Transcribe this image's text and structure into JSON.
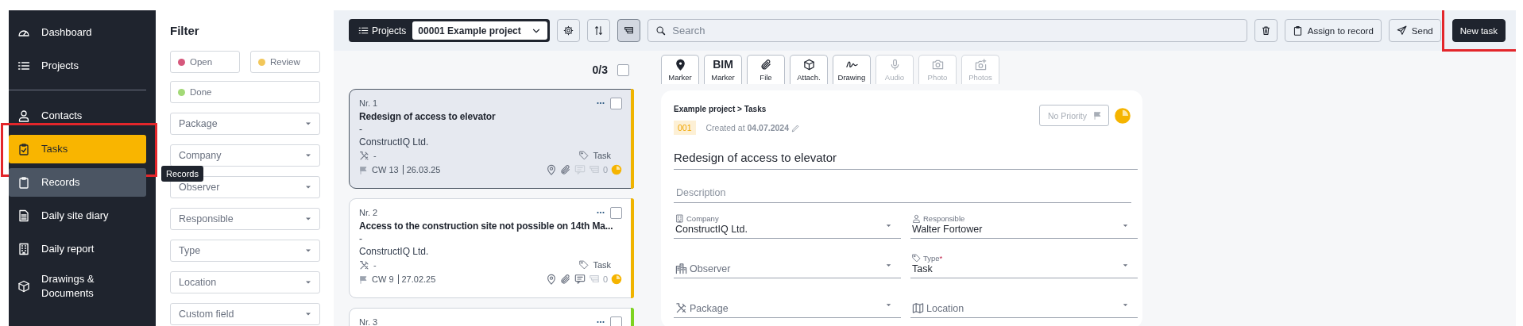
{
  "sidebar": {
    "items": [
      {
        "kind": "dashboard",
        "label": "Dashboard",
        "selected": false,
        "hovered": false
      },
      {
        "kind": "projects",
        "label": "Projects",
        "selected": false,
        "hovered": false,
        "divider_after": true
      },
      {
        "kind": "contacts",
        "label": "Contacts",
        "selected": false,
        "hovered": false
      },
      {
        "kind": "tasks",
        "label": "Tasks",
        "selected": true,
        "hovered": false,
        "highlighted": true
      },
      {
        "kind": "records",
        "label": "Records",
        "selected": false,
        "hovered": true
      },
      {
        "kind": "diary",
        "label": "Daily site diary",
        "selected": false,
        "hovered": false
      },
      {
        "kind": "report",
        "label": "Daily report",
        "selected": false,
        "hovered": false
      },
      {
        "kind": "drawings",
        "label": "Drawings & Documents",
        "selected": false,
        "hovered": false
      }
    ],
    "tooltip": "Records"
  },
  "filter": {
    "title": "Filter",
    "statuses": [
      {
        "label": "Open",
        "color": "#d6587c"
      },
      {
        "label": "Review",
        "color": "#f2c75a"
      },
      {
        "label": "Done",
        "color": "#a3d977"
      }
    ],
    "dropdowns": [
      "Package",
      "Company",
      "Observer",
      "Responsible",
      "Type",
      "Location",
      "Custom field"
    ]
  },
  "toolbar": {
    "projects_label": "Projects",
    "project": "00001 Example project",
    "tools": [
      {
        "kind": "settings",
        "selected": false
      },
      {
        "kind": "sort",
        "selected": false
      },
      {
        "kind": "filter",
        "selected": true
      }
    ],
    "search": {
      "placeholder": "Search"
    },
    "actions": [
      {
        "kind": "delete"
      },
      {
        "kind": "assign",
        "label": "Assign to record"
      },
      {
        "kind": "send",
        "label": "Send"
      },
      {
        "kind": "primary",
        "label": "New task",
        "highlighted": true
      }
    ]
  },
  "list": {
    "count": "0/3",
    "all_checked": false,
    "tasks": [
      {
        "number": "Nr. 1",
        "title": "Redesign of access to elevator",
        "description": "-",
        "company": "ConstructIQ Ltd.",
        "package": "-",
        "type": "Task",
        "week": "CW 13",
        "date": "26.03.25",
        "comments": false,
        "subtasks": "0",
        "color": "#f0b400",
        "selected": true,
        "checked": false
      },
      {
        "number": "Nr. 2",
        "title": "Access to the construction site not possible on 14th Ma...",
        "description": "-",
        "company": "ConstructIQ Ltd.",
        "package": "-",
        "type": "Task",
        "week": "CW 9",
        "date": "27.02.25",
        "comments": true,
        "subtasks": "0",
        "color": "#f0b400",
        "selected": false,
        "checked": false
      },
      {
        "number": "Nr. 3",
        "color": "#7ed321",
        "selected": false,
        "checked": false
      }
    ]
  },
  "detail": {
    "media": [
      {
        "kind": "marker",
        "label": "Marker",
        "disabled": false
      },
      {
        "kind": "bim",
        "glyph": "BIM",
        "label": "Marker",
        "disabled": false
      },
      {
        "kind": "file",
        "label": "File",
        "disabled": false
      },
      {
        "kind": "attachment",
        "label": "Attach.",
        "disabled": false
      },
      {
        "kind": "drawing",
        "label": "Drawing",
        "disabled": false
      },
      {
        "kind": "audio",
        "label": "Audio",
        "disabled": true
      },
      {
        "kind": "photo",
        "label": "Photo",
        "disabled": true
      },
      {
        "kind": "photos",
        "label": "Photos",
        "disabled": true
      }
    ],
    "breadcrumb": "Example project > Tasks",
    "id": "001",
    "created": "Created at **04.07.2024**",
    "priority": "No Priority",
    "title": "Redesign of access to elevator",
    "description": {
      "placeholder": "Description"
    },
    "fields": [
      {
        "kind": "company",
        "label": "Company",
        "value": "ConstructIQ Ltd."
      },
      {
        "kind": "responsible",
        "label": "Responsible",
        "value": "Walter Fortower"
      },
      {
        "kind": "observer",
        "placeholder": "Observer"
      },
      {
        "kind": "type",
        "label": "Type",
        "required_mark": "*",
        "value": "Task"
      },
      {
        "kind": "package",
        "placeholder": "Package"
      },
      {
        "kind": "location",
        "placeholder": "Location"
      }
    ]
  }
}
